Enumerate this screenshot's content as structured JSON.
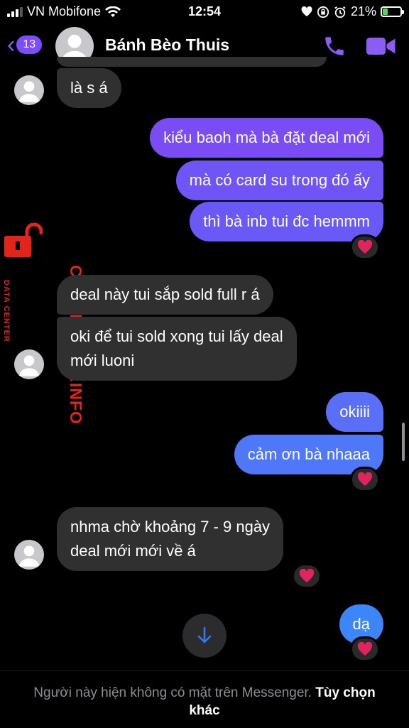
{
  "status_bar": {
    "carrier": "VN Mobifone",
    "time": "12:54",
    "battery": "21%"
  },
  "header": {
    "unread_count": "13",
    "contact_name": "Bánh Bèo Thuis"
  },
  "messages": [
    {
      "text": "là s á",
      "direction": "in"
    },
    {
      "text": "kiểu baoh mà bà đặt deal mới",
      "direction": "out"
    },
    {
      "text": "mà có card su trong đó ấy",
      "direction": "out"
    },
    {
      "text": "thì bà inb tui đc hemmm",
      "direction": "out",
      "reaction": "heart"
    },
    {
      "text": "deal này tui sắp sold full r á",
      "direction": "in"
    },
    {
      "text_lines": [
        "oki để tui sold xong tui lấy deal",
        "mới luoni"
      ],
      "direction": "in"
    },
    {
      "text": "okiiii",
      "direction": "out"
    },
    {
      "text": "cảm ơn bà nhaaa",
      "direction": "out",
      "reaction": "heart"
    },
    {
      "text_lines": [
        "nhma chờ khoảng 7 - 9 ngày",
        "deal mới mới về á"
      ],
      "direction": "in",
      "reaction": "heart"
    },
    {
      "text": "dạ",
      "direction": "out",
      "reaction": "heart"
    }
  ],
  "watermark": {
    "main": "CHECKSCAM.INFO",
    "sub": "DATA CENTER"
  },
  "footer": {
    "note": "Người này hiện không có mặt trên Messenger.",
    "link": "Tùy chọn khác"
  },
  "colors": {
    "accent": "#7c4dff",
    "bubble_incoming": "#303030",
    "watermark": "#e3241b",
    "heart": "#e0245e"
  },
  "icons": [
    "back-chevron-icon",
    "phone-icon",
    "video-call-icon",
    "avatar-icon",
    "heart-reaction-icon",
    "arrow-down-icon",
    "lock-icon",
    "wifi-icon",
    "heart-status-icon",
    "rotation-lock-icon",
    "alarm-icon",
    "battery-icon"
  ]
}
